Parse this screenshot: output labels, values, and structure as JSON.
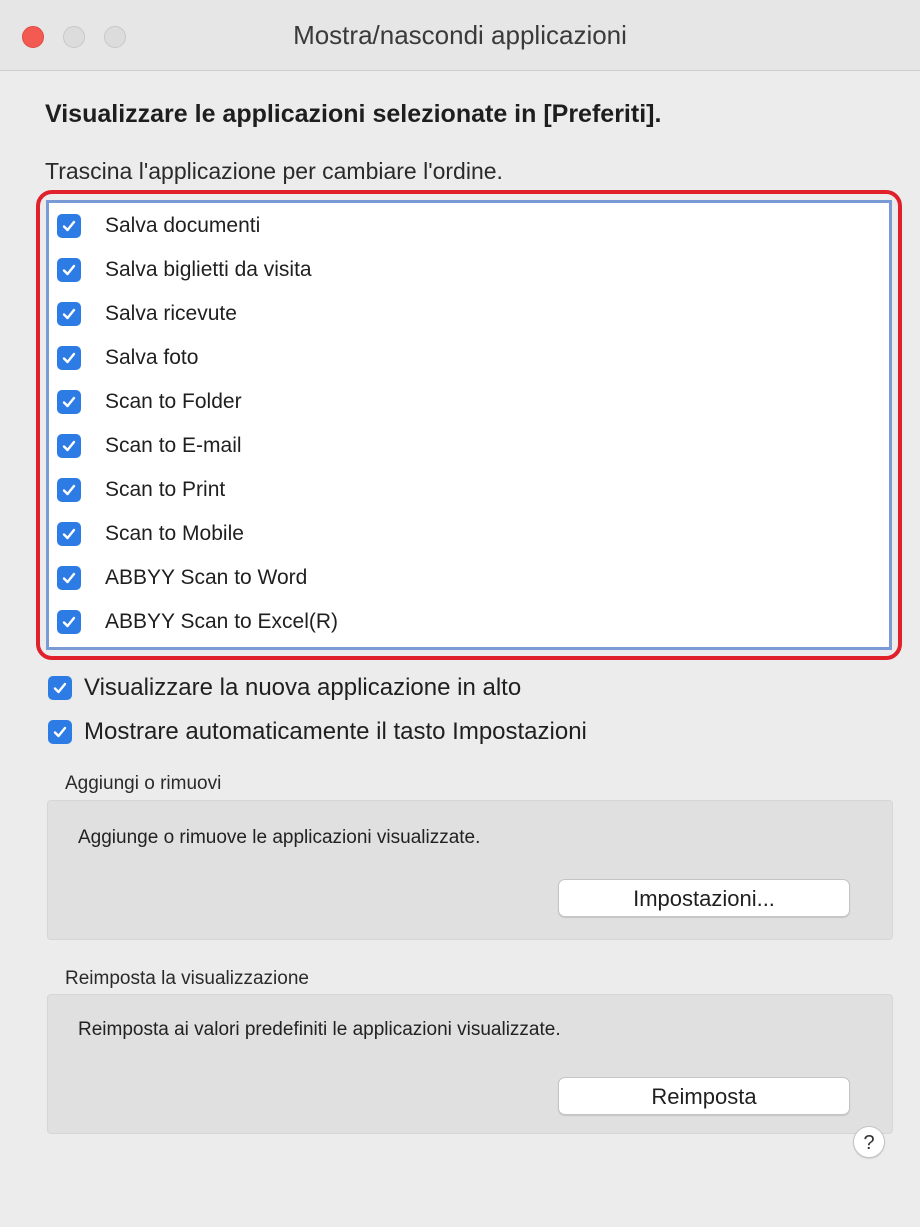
{
  "window": {
    "title": "Mostra/nascondi applicazioni"
  },
  "heading": "Visualizzare le applicazioni selezionate in [Preferiti].",
  "instruction": "Trascina l'applicazione per cambiare l'ordine.",
  "apps": [
    {
      "label": "Salva documenti",
      "checked": true
    },
    {
      "label": "Salva biglietti da visita",
      "checked": true
    },
    {
      "label": "Salva ricevute",
      "checked": true
    },
    {
      "label": "Salva foto",
      "checked": true
    },
    {
      "label": "Scan to Folder",
      "checked": true
    },
    {
      "label": "Scan to E-mail",
      "checked": true
    },
    {
      "label": "Scan to Print",
      "checked": true
    },
    {
      "label": "Scan to Mobile",
      "checked": true
    },
    {
      "label": "ABBYY Scan to Word",
      "checked": true
    },
    {
      "label": "ABBYY Scan to Excel(R)",
      "checked": true
    }
  ],
  "options": {
    "new_app_top": {
      "label": "Visualizzare la nuova applicazione in alto",
      "checked": true
    },
    "auto_settings": {
      "label": "Mostrare automaticamente il tasto Impostazioni",
      "checked": true
    }
  },
  "add_remove": {
    "title": "Aggiungi o rimuovi",
    "description": "Aggiunge o rimuove le applicazioni visualizzate.",
    "button_label": "Impostazioni..."
  },
  "reset": {
    "title": "Reimposta la visualizzazione",
    "description": "Reimposta ai valori predefiniti le applicazioni visualizzate.",
    "button_label": "Reimposta"
  },
  "help": {
    "label": "?"
  },
  "colors": {
    "checkbox": "#2d7be5",
    "highlight_frame": "#e0202a",
    "list_border": "#7a9ad6",
    "close_button": "#f25a52"
  }
}
